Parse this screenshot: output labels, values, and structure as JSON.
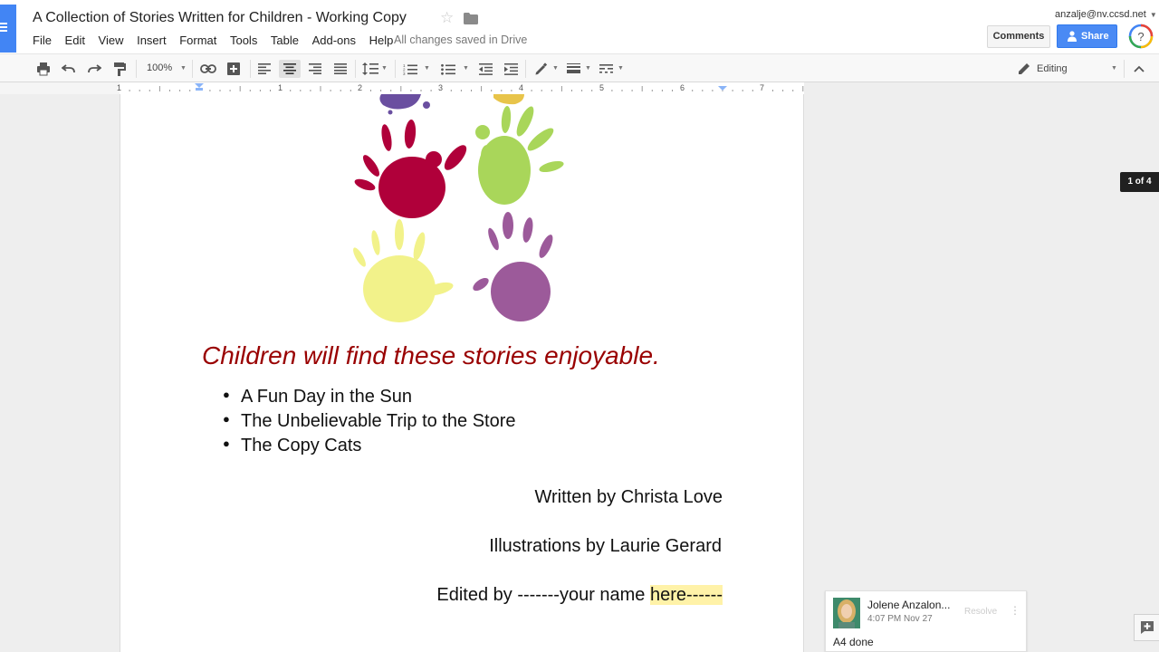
{
  "app": {
    "accent_color": "#4285f4"
  },
  "header": {
    "title": "A Collection of Stories Written for Children - Working Copy",
    "menu": [
      "File",
      "Edit",
      "View",
      "Insert",
      "Format",
      "Tools",
      "Table",
      "Add-ons",
      "Help"
    ],
    "save_status": "All changes saved in Drive",
    "user_email": "anzalje@nv.ccsd.net",
    "comments_label": "Comments",
    "share_label": "Share",
    "share_color": "#4a8af4"
  },
  "toolbar": {
    "zoom": "100%",
    "mode_label": "Editing",
    "icons": [
      "print-icon",
      "undo-icon",
      "redo-icon",
      "paint-format-icon",
      "link-icon",
      "insert-comment-icon",
      "align-left-icon",
      "align-center-icon",
      "align-right-icon",
      "align-justify-icon",
      "line-spacing-icon",
      "numbered-list-icon",
      "bulleted-list-icon",
      "decrease-indent-icon",
      "increase-indent-icon",
      "highlight-pen-icon",
      "line-weight-icon",
      "line-dash-icon",
      "pencil-icon",
      "collapse-icon"
    ],
    "active_alignment": "center"
  },
  "ruler": {
    "numbers": [
      "1",
      "1",
      "2",
      "3",
      "4",
      "5",
      "6",
      "7"
    ]
  },
  "document": {
    "headline": "Children will find these stories enjoyable.",
    "headline_color": "#990000",
    "stories": [
      "A Fun Day in the Sun",
      "The Unbelievable Trip to the Store",
      "The Copy Cats"
    ],
    "credit_written": "Written by Christa Love",
    "credit_illustrations": "Illustrations by Laurie Gerard",
    "credit_edited_prefix": "Edited by -------your name ",
    "credit_edited_highlight": "here------",
    "highlight_color": "#fff2a8",
    "image_colors": [
      "#6a4fa0",
      "#e8c44a",
      "#b0003a",
      "#a9d65a",
      "#f2f28a",
      "#9c5a9a"
    ]
  },
  "page_indicator": "1 of 4",
  "comment": {
    "author": "Jolene Anzalon...",
    "time": "4:07 PM Nov 27",
    "resolve_label": "Resolve",
    "text": "A4 done"
  }
}
